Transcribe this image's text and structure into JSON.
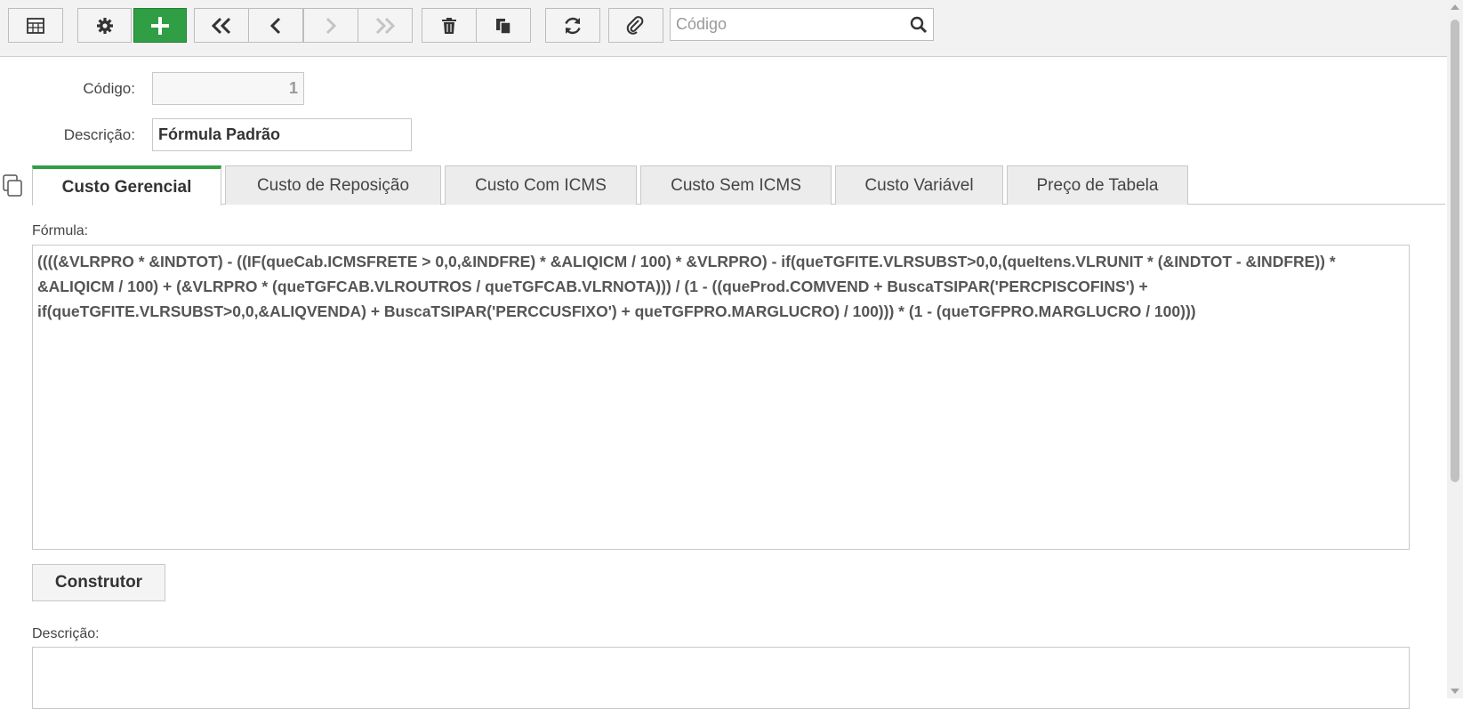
{
  "toolbar": {
    "search_placeholder": "Código",
    "buttons": [
      "grid-view",
      "settings",
      "add",
      "first",
      "previous",
      "next",
      "last",
      "delete",
      "duplicate",
      "refresh",
      "attach"
    ]
  },
  "form": {
    "codigo_label": "Código:",
    "codigo_value": "1",
    "descricao_label": "Descrição:",
    "descricao_value": "Fórmula Padrão"
  },
  "tabs": [
    {
      "label": "Custo Gerencial",
      "active": true
    },
    {
      "label": "Custo de Reposição",
      "active": false
    },
    {
      "label": "Custo Com ICMS",
      "active": false
    },
    {
      "label": "Custo Sem ICMS",
      "active": false
    },
    {
      "label": "Custo Variável",
      "active": false
    },
    {
      "label": "Preço de Tabela",
      "active": false
    }
  ],
  "formula": {
    "label": "Fórmula:",
    "value": "((((&VLRPRO * &INDTOT) - ((IF(queCab.ICMSFRETE > 0,0,&INDFRE) * &ALIQICM / 100) * &VLRPRO) - if(queTGFITE.VLRSUBST>0,0,(queItens.VLRUNIT * (&INDTOT - &INDFRE)) * &ALIQICM / 100) + (&VLRPRO * (queTGFCAB.VLROUTROS / queTGFCAB.VLRNOTA))) / (1 - ((queProd.COMVEND + BuscaTSIPAR('PERCPISCOFINS') + if(queTGFITE.VLRSUBST>0,0,&ALIQVENDA) + BuscaTSIPAR('PERCCUSFIXO') + queTGFPRO.MARGLUCRO) / 100))) * (1 -  (queTGFPRO.MARGLUCRO / 100)))"
  },
  "construtor_label": "Construtor",
  "descricao2_label": "Descrição:",
  "colors": {
    "accent": "#2f9e44"
  }
}
